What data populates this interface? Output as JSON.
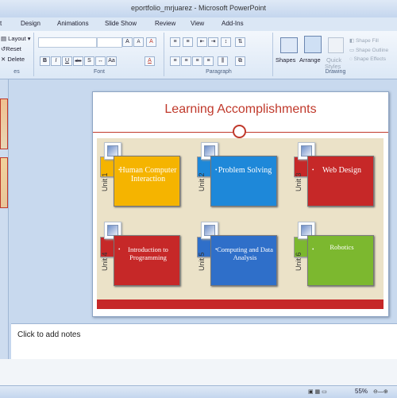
{
  "window": {
    "title": "eportfolio_mrjuarez - Microsoft PowerPoint"
  },
  "tabs": [
    {
      "label": "t"
    },
    {
      "label": "Design"
    },
    {
      "label": "Animations"
    },
    {
      "label": "Slide Show"
    },
    {
      "label": "Review"
    },
    {
      "label": "View"
    },
    {
      "label": "Add-Ins"
    }
  ],
  "ribbon": {
    "slides": {
      "layout": "Layout",
      "reset": "Reset",
      "delete": "Delete",
      "group": "es"
    },
    "font": {
      "group": "Font",
      "bold": "B",
      "italic": "I",
      "underline": "U",
      "strike": "abc",
      "grow": "A",
      "shrink": "A",
      "clear": "A",
      "aa": "Aa",
      "color": "A"
    },
    "paragraph": {
      "group": "Paragraph"
    },
    "drawing": {
      "group": "Drawing",
      "shapes": "Shapes",
      "arrange": "Arrange",
      "quick": "Quick",
      "styles": "Styles",
      "fill": "Shape Fill",
      "outline": "Shape Outline",
      "effects": "Shape Effects"
    }
  },
  "slide": {
    "title": "Learning Accomplishments",
    "units": [
      {
        "label": "Unit 1",
        "text": "Human Computer Interaction",
        "color": "#f5b400"
      },
      {
        "label": "Unit 2",
        "text": "Problem Solving",
        "color": "#1e88d9"
      },
      {
        "label": "Unit 3",
        "text": "Web Design",
        "color": "#c62828"
      },
      {
        "label": "Unit 4",
        "text": "Introduction to Programming",
        "color": "#c62828"
      },
      {
        "label": "Unit 5",
        "text": "Computing and Data Analysis",
        "color": "#2f6fc9"
      },
      {
        "label": "Unit 6",
        "text": "Robotics",
        "color": "#7cb82f"
      }
    ]
  },
  "notes": {
    "placeholder": "Click to add notes"
  },
  "status": {
    "zoom": "55%"
  },
  "colors": {
    "accent": "#c0392b",
    "ribbon": "#dce8f6",
    "slide_bg": "#ebe2c8"
  }
}
